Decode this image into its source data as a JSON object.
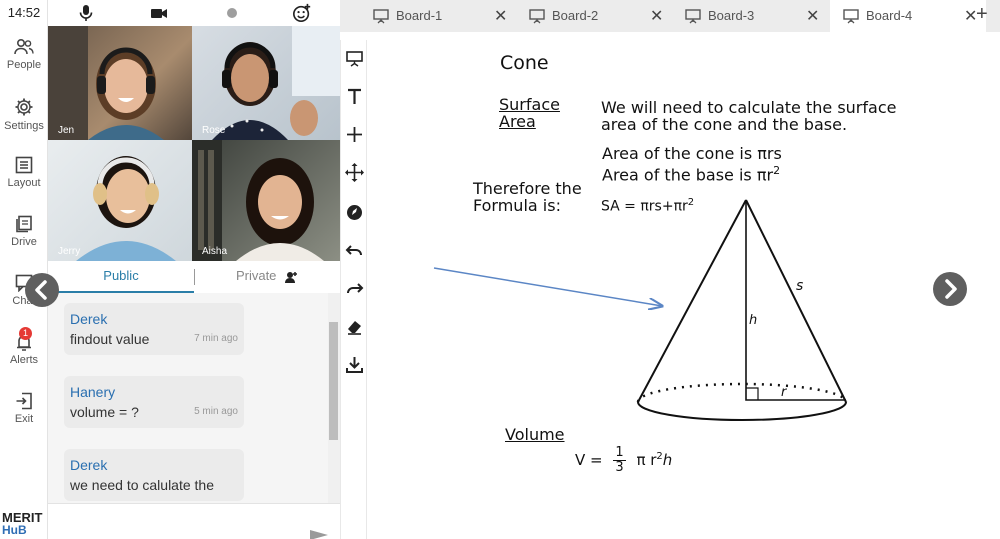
{
  "status": {
    "time": "14:52"
  },
  "rail": {
    "items": [
      {
        "label": "People",
        "icon": "people-icon"
      },
      {
        "label": "Settings",
        "icon": "gear-icon"
      },
      {
        "label": "Layout",
        "icon": "layout-icon"
      },
      {
        "label": "Drive",
        "icon": "drive-icon"
      },
      {
        "label": "Chat",
        "icon": "chat-icon"
      },
      {
        "label": "Alerts",
        "icon": "alert-icon",
        "badge": "1"
      },
      {
        "label": "Exit",
        "icon": "exit-icon"
      }
    ],
    "brand_top": "MERIT",
    "brand_bottom": "HuB"
  },
  "media": {
    "icons": [
      "microphone-icon",
      "camera-icon",
      "record-dot-icon",
      "emoji-add-icon"
    ]
  },
  "participants": [
    {
      "name": "Jen"
    },
    {
      "name": "Rose"
    },
    {
      "name": "Jerry"
    },
    {
      "name": "Aisha"
    }
  ],
  "chat": {
    "tabs": [
      {
        "label": "Public",
        "active": true
      },
      {
        "label": "Private",
        "active": false
      }
    ],
    "messages": [
      {
        "author": "Derek",
        "text": "findout value",
        "time": "7 min ago"
      },
      {
        "author": "Hanery",
        "text": "volume  = ?",
        "time": "5 min ago"
      },
      {
        "author": "Derek",
        "text": "we need to calulate the",
        "time": ""
      }
    ]
  },
  "boards": {
    "tabs": [
      {
        "label": "Board-1",
        "active": false
      },
      {
        "label": "Board-2",
        "active": false
      },
      {
        "label": "Board-3",
        "active": false
      },
      {
        "label": "Board-4",
        "active": true
      }
    ],
    "add_label": "+"
  },
  "tools": [
    "whiteboard-icon",
    "text-icon",
    "plus-icon",
    "move-icon",
    "pen-icon",
    "undo-icon",
    "redo-icon",
    "eraser-icon",
    "download-icon"
  ],
  "board_content": {
    "title": "Cone",
    "surface_area_heading_1": "Surface",
    "surface_area_heading_2": "Area",
    "surface_text_1": "We will need to calculate the surface",
    "surface_text_2": "area of the cone and the base.",
    "cone_area": "Area of the cone is πrs",
    "base_area": "Area of the base is πr",
    "base_area_exp": "2",
    "therefore_1": "Therefore the",
    "therefore_2": "Formula is:",
    "sa_formula": "SA = πrs+πr",
    "sa_exp": "2",
    "label_s": "s",
    "label_h": "h",
    "label_r": "r",
    "volume_heading": "Volume",
    "volume_lhs": "V =",
    "volume_num": "1",
    "volume_den": "3",
    "volume_rhs": "π  r",
    "volume_exp": "2",
    "volume_h": "h",
    "colors": {
      "annotation_arrow": "#5b86c5",
      "accent": "#2a7ea8"
    }
  }
}
